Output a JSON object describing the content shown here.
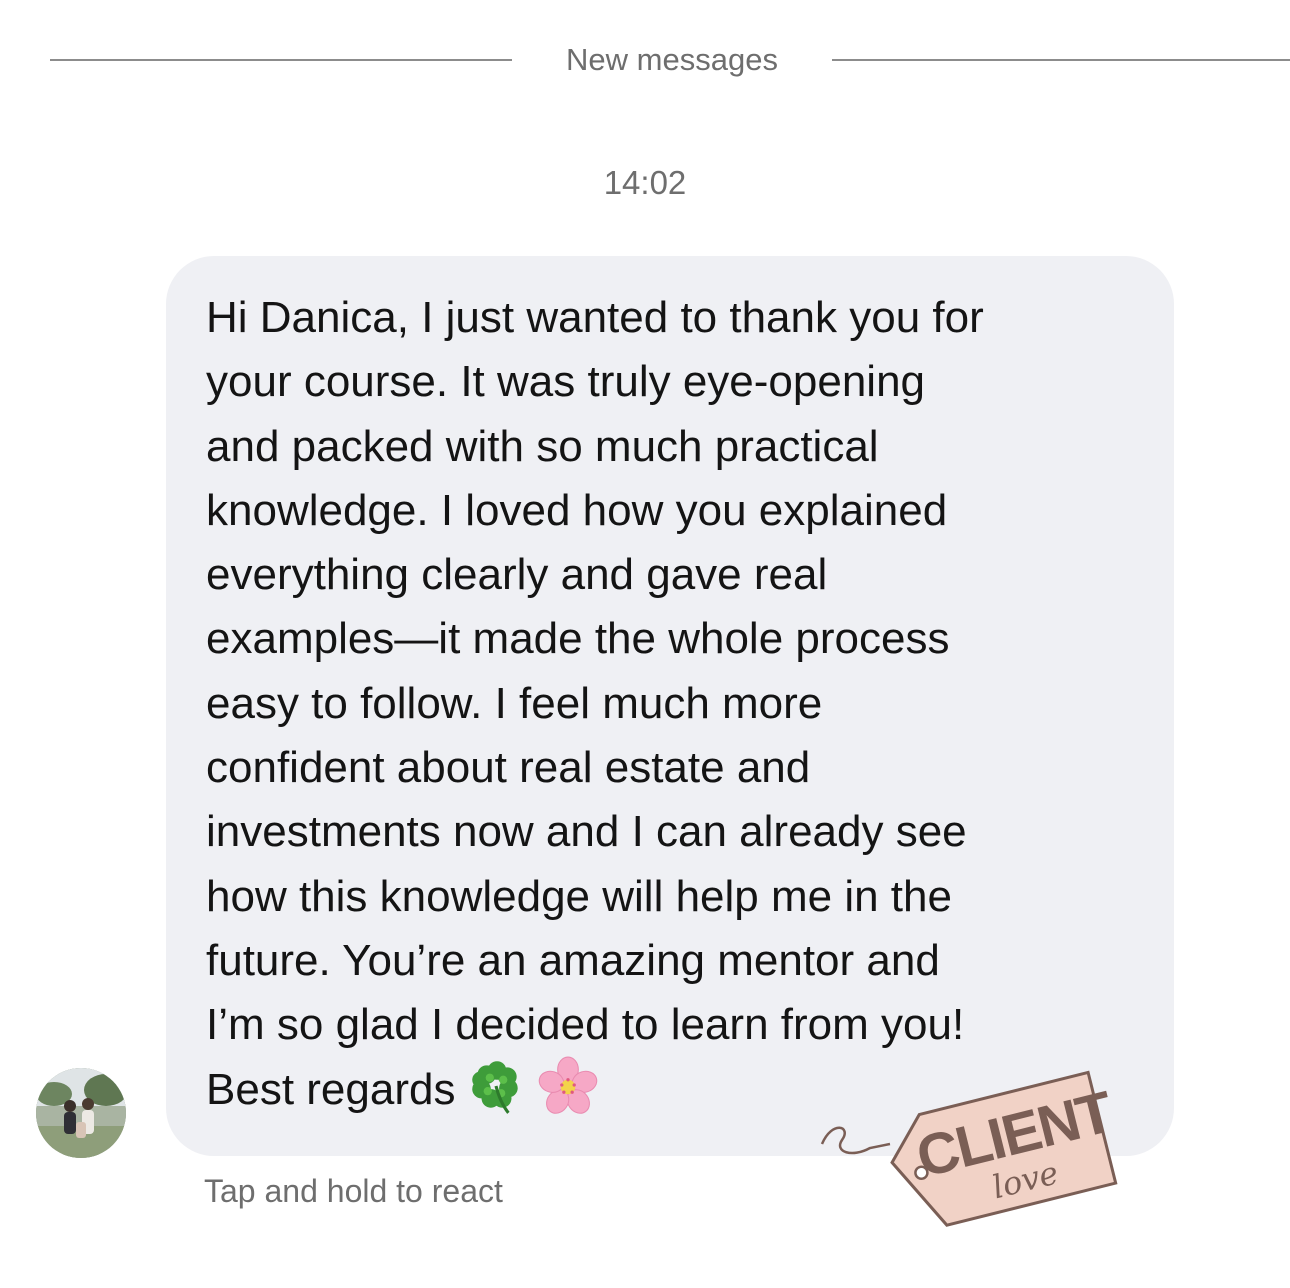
{
  "divider": {
    "label": "New messages"
  },
  "timestamp": "14:02",
  "message": {
    "text": "Hi Danica, I just wanted to thank you for\nyour course. It was truly eye-opening\nand packed with so much practical\nknowledge. I loved how you explained\neverything clearly and gave real\nexamples—it made the whole process\neasy to follow. I feel much more\nconfident about real estate and\ninvestments now and I can already see\nhow this knowledge will help me in the\nfuture. You’re an amazing mentor and\nI’m so glad I decided to learn from you!\nBest regards",
    "emojis": [
      "four-leaf-clover",
      "cherry-blossom"
    ]
  },
  "react_hint": "Tap and hold to react",
  "sticker": {
    "line1": "CLIENT",
    "line2": "love"
  },
  "colors": {
    "bubble": "#eff0f4",
    "secondary_text": "#6e6e6e",
    "divider": "#8c8c8c",
    "tag_fill": "#f1d2c6",
    "tag_text": "#7a5e55"
  }
}
